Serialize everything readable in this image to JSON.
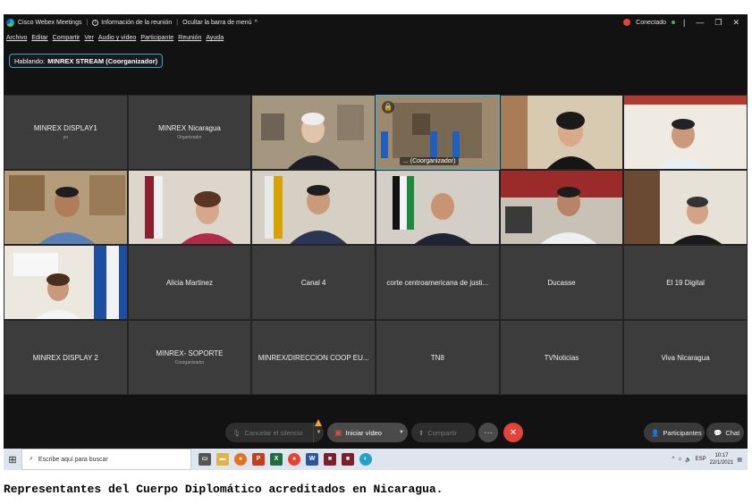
{
  "titlebar": {
    "app": "Cisco Webex Meetings",
    "meeting_info": "Información de la reunión",
    "hide_menu": "Ocultar la barra de menú",
    "status": "Conectado"
  },
  "menu": [
    "Archivo",
    "Editar",
    "Compartir",
    "Ver",
    "Audio y vídeo",
    "Participante",
    "Reunión",
    "Ayuda"
  ],
  "speaking": {
    "label": "Hablando:",
    "name": "MINREX STREAM (Coorganizador)"
  },
  "tiles": {
    "r1c1": {
      "name": "MINREX DISPLAY1",
      "sub": "yo"
    },
    "r1c2": {
      "name": "MINREX Nicaragua",
      "sub": "Organizador"
    },
    "r1c4": {
      "label": "... (Coorganizador)"
    },
    "r3c2": {
      "name": "Alicia Martinez"
    },
    "r3c3": {
      "name": "Canal 4"
    },
    "r3c4": {
      "name": "corte centroamericana de justi..."
    },
    "r3c5": {
      "name": "Ducasse"
    },
    "r3c6": {
      "name": "El 19 Digital"
    },
    "r4c1": {
      "name": "MINREX DISPLAY 2"
    },
    "r4c2": {
      "name": "MINREX- SOPORTE",
      "sub": "Coorganizador"
    },
    "r4c3": {
      "name": "MINREX/DIRECCION COOP EU..."
    },
    "r4c4": {
      "name": "TN8"
    },
    "r4c5": {
      "name": "TVNoticias"
    },
    "r4c6": {
      "name": "Viva Nicaragua"
    }
  },
  "controls": {
    "mute": "Cancelar el silencio",
    "video": "Iniciar vídeo",
    "share": "Compartir",
    "participants": "Participantes",
    "chat": "Chat"
  },
  "taskbar": {
    "search_placeholder": "Escribe aquí para buscar",
    "lang": "ESP",
    "time": "10:17",
    "date": "22/1/2021"
  },
  "caption": "Representantes del Cuerpo Diplomático acreditados en Nicaragua.",
  "colors": {
    "accent": "#38b7e3",
    "end": "#e0443a",
    "bg": "#121212"
  }
}
